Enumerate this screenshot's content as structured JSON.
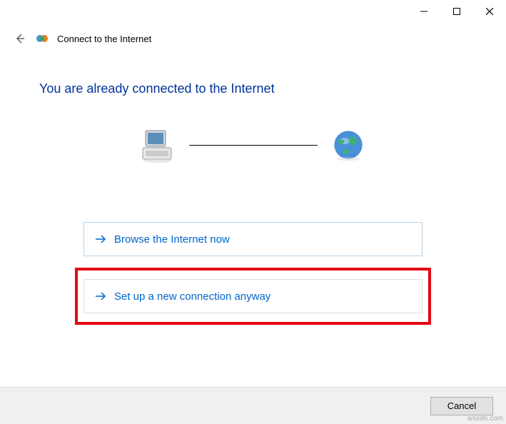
{
  "titlebar": {
    "minimize": "minimize",
    "maximize": "maximize",
    "close": "close"
  },
  "header": {
    "title": "Connect to the Internet"
  },
  "main": {
    "heading": "You are already connected to the Internet"
  },
  "options": {
    "browse": "Browse the Internet now",
    "setup": "Set up a new connection anyway"
  },
  "footer": {
    "cancel": "Cancel"
  },
  "watermark": "wsxdn.com"
}
